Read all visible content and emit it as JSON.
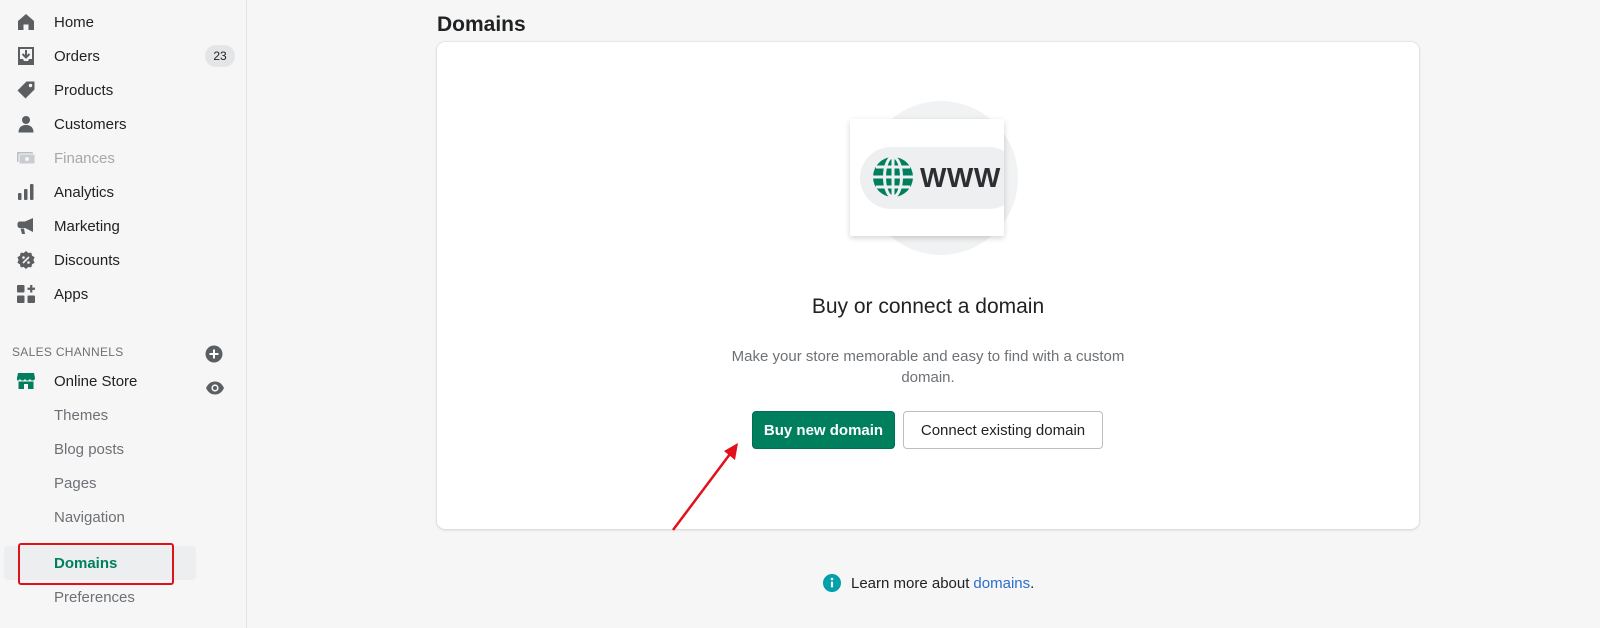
{
  "sidebar": {
    "items": [
      {
        "label": "Home",
        "icon": "home-icon"
      },
      {
        "label": "Orders",
        "icon": "orders-icon",
        "badge": "23"
      },
      {
        "label": "Products",
        "icon": "tag-icon"
      },
      {
        "label": "Customers",
        "icon": "person-icon"
      },
      {
        "label": "Finances",
        "icon": "finances-icon",
        "disabled": true
      },
      {
        "label": "Analytics",
        "icon": "bar-chart-icon"
      },
      {
        "label": "Marketing",
        "icon": "megaphone-icon"
      },
      {
        "label": "Discounts",
        "icon": "discount-icon"
      },
      {
        "label": "Apps",
        "icon": "apps-icon"
      }
    ],
    "sales_channels_label": "SALES CHANNELS",
    "online_store": {
      "label": "Online Store",
      "icon": "store-icon"
    },
    "sub_items": [
      {
        "label": "Themes"
      },
      {
        "label": "Blog posts"
      },
      {
        "label": "Pages"
      },
      {
        "label": "Navigation"
      },
      {
        "label": "Domains",
        "active": true
      },
      {
        "label": "Preferences"
      }
    ]
  },
  "main": {
    "title": "Domains",
    "card": {
      "illustration_text": "WWW",
      "heading": "Buy or connect a domain",
      "description": "Make your store memorable and easy to find with a custom domain.",
      "primary_button": "Buy new domain",
      "secondary_button": "Connect existing domain"
    },
    "footer": {
      "text": "Learn more about",
      "link": "domains",
      "suffix": "."
    }
  },
  "colors": {
    "brand_green": "#007f5f",
    "link_blue": "#2c6ecb",
    "annotation_red": "#e2101b",
    "info_teal": "#00a0ac"
  }
}
